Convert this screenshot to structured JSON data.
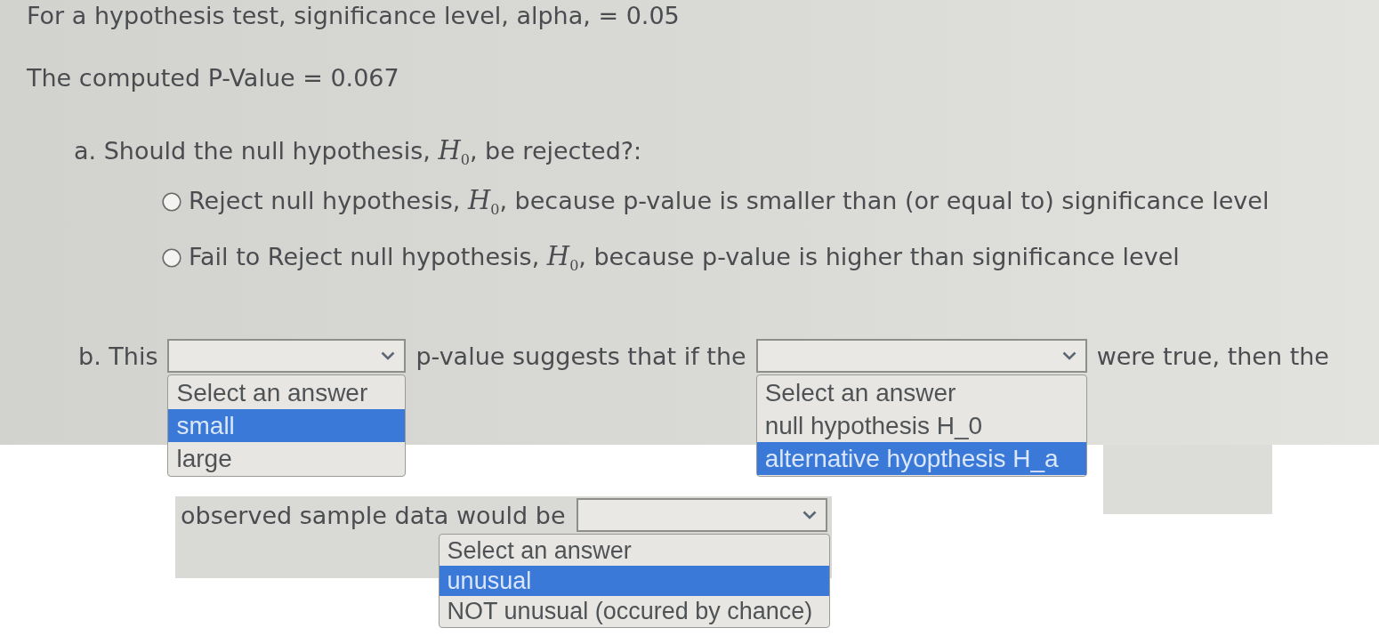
{
  "intro": [
    "For a hypothesis test, significance level, alpha, = 0.05",
    "The computed P-Value = 0.067"
  ],
  "part_a": {
    "question": "a. Should the null hypothesis, *H*$_{0}$, be rejected?:",
    "choices": [
      {
        "label": "Reject null hypothesis, *H*$_{0}$, because p-value is smaller than (or equal to) significance level",
        "selected": false
      },
      {
        "label": "Fail to Reject null hypothesis, *H*$_{0}$, because p-value is higher than significance level",
        "selected": false
      }
    ]
  },
  "part_b": {
    "line_1": [
      {
        "kind": "text",
        "text": "b. This"
      },
      {
        "kind": "select",
        "options": [
          {
            "label": "Select an answer",
            "selected": false
          },
          {
            "label": "small",
            "selected": true
          },
          {
            "label": "large",
            "selected": false
          }
        ]
      },
      {
        "kind": "text",
        "text": "p-value suggests that if the"
      },
      {
        "kind": "select",
        "options": [
          {
            "label": "Select an answer",
            "selected": false
          },
          {
            "label": "null hypothesis H_0",
            "selected": false
          },
          {
            "label": "alternative hyopthesis H_a",
            "selected": true
          }
        ]
      },
      {
        "kind": "text",
        "text": "were true, then the"
      }
    ],
    "line_2": [
      {
        "kind": "text",
        "text": "observed sample data would be"
      },
      {
        "kind": "select",
        "options": [
          {
            "label": "Select an answer",
            "selected": false
          },
          {
            "label": "unusual",
            "selected": true
          },
          {
            "label": "NOT unusual (occured by chance)",
            "selected": false
          }
        ]
      }
    ]
  }
}
